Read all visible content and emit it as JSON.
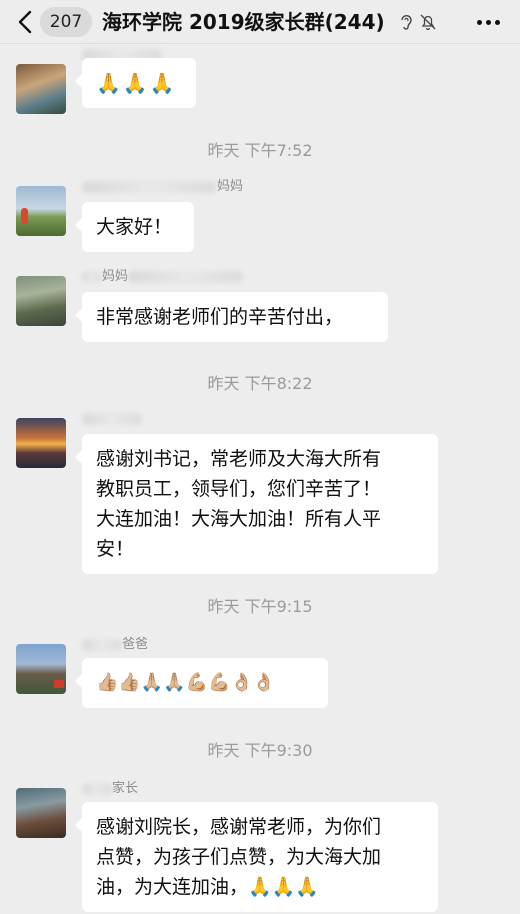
{
  "header": {
    "back_icon": "chevron-left-icon",
    "unread_count": "207",
    "title": "海环学院 2019级家长群(244)",
    "icons": [
      "ear-icon",
      "bell-muted-icon",
      "more-dots-icon"
    ]
  },
  "messages": [
    {
      "sender": "",
      "text": "🙏🙏🙏"
    },
    {
      "time": "昨天 下午7:52"
    },
    {
      "sender_suffix": "妈妈",
      "text": "大家好！"
    },
    {
      "sender_prefix": "妈妈",
      "text": "非常感谢老师们的辛苦付出，"
    },
    {
      "time": "昨天 下午8:22"
    },
    {
      "sender": "",
      "text": "感谢刘书记，常老师及大海大所有教职员工，领导们，您们辛苦了！大连加油！大海大加油！所有人平安！",
      "lines": [
        "感谢刘书记，常老师及大海大所有",
        "教职员工，领导们，您们辛苦了！",
        "大连加油！大海大加油！所有人平",
        "安！"
      ]
    },
    {
      "time": "昨天 下午9:15"
    },
    {
      "sender_suffix": "爸爸",
      "text": "👍🏼👍🏼🙏🏼🙏🏼💪🏼💪🏼👌🏼👌🏼"
    },
    {
      "time": "昨天 下午9:30"
    },
    {
      "sender_suffix": "家长",
      "text": "感谢刘院长，感谢常老师，为你们点赞，为孩子们点赞，为大海大加油，为大连加油，🙏🙏🙏",
      "lines": [
        "感谢刘院长，感谢常老师，为你们",
        "点赞，为孩子们点赞，为大海大加",
        "油，为大连加油，🙏🙏🙏"
      ]
    }
  ]
}
